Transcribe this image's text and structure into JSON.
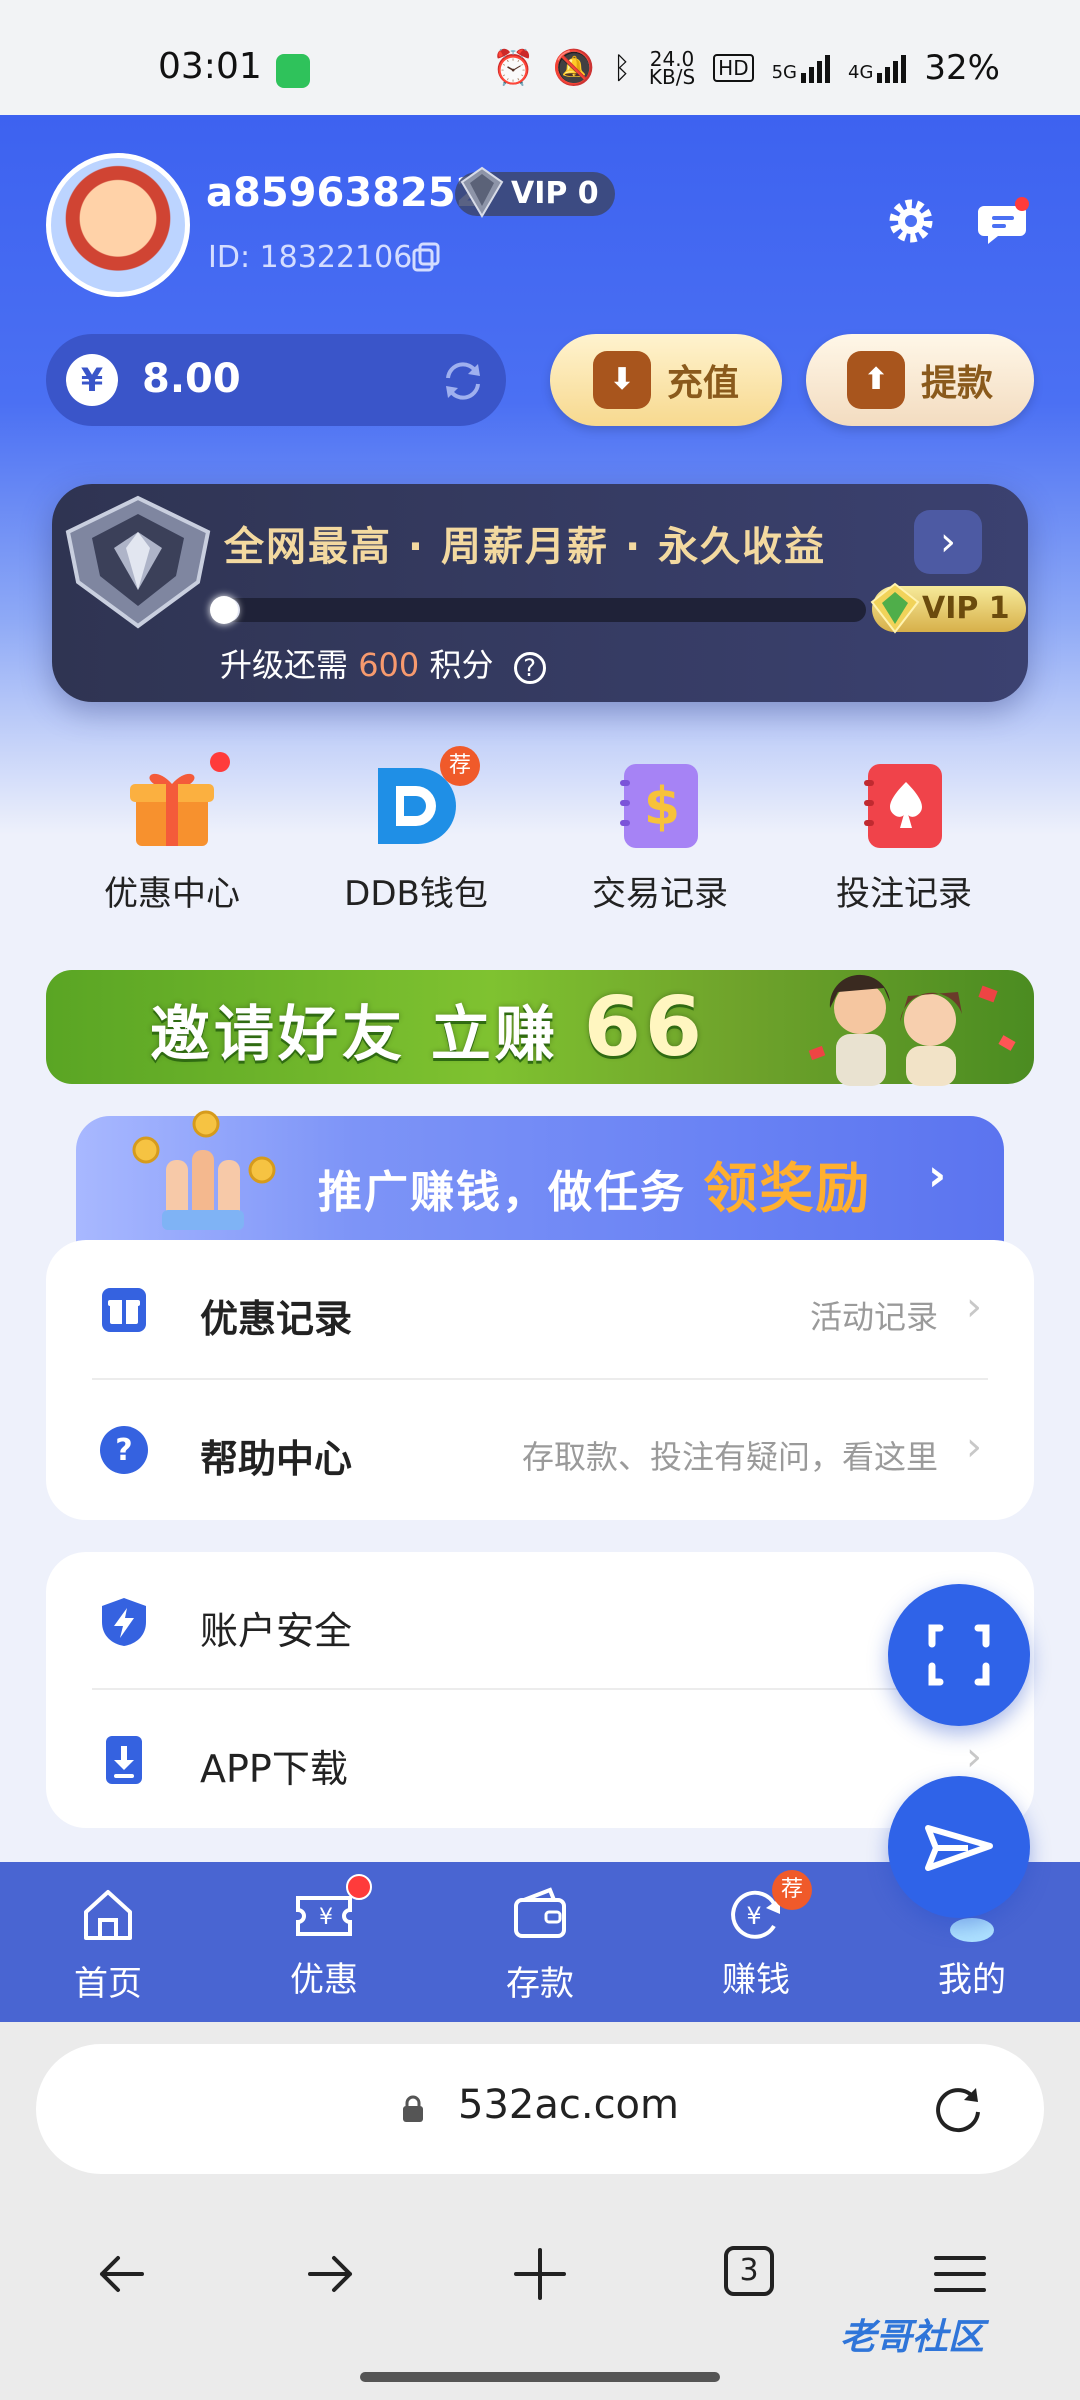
{
  "status_bar": {
    "time": "03:01",
    "net_speed": "24.0",
    "net_unit": "KB/S",
    "hd": "HD",
    "signal1": "5G",
    "signal2": "4G",
    "battery": "32%"
  },
  "profile": {
    "username": "a859638252",
    "vip_level": "VIP 0",
    "user_id": "ID: 18322106"
  },
  "wallet": {
    "currency_symbol": "¥",
    "balance": "8.00",
    "recharge_label": "充值",
    "withdraw_label": "提款"
  },
  "vip_card": {
    "title": "全网最高 · 周薪月薪 · 永久收益",
    "next_level": "VIP 1",
    "progress_prefix": "升级还需",
    "points_needed": "600",
    "progress_suffix": "积分",
    "progress_fraction": 0.02
  },
  "quick_actions": [
    {
      "label": "优惠中心",
      "icon": "gift-icon",
      "color": "#f7912e"
    },
    {
      "label": "DDB钱包",
      "icon": "ddb-wallet-icon",
      "badge": "荐",
      "color": "#1f8fe6"
    },
    {
      "label": "交易记录",
      "icon": "transaction-icon",
      "color": "#9b6cf2"
    },
    {
      "label": "投注记录",
      "icon": "betting-record-icon",
      "color": "#f0434a"
    }
  ],
  "invite_banner": {
    "text": "邀请好友 立赚",
    "amount": "66"
  },
  "promo_banner": {
    "text": "推广赚钱，做任务",
    "highlight": "领奖励"
  },
  "menu_card1": [
    {
      "label": "优惠记录",
      "desc": "活动记录",
      "icon": "gift-record-icon"
    },
    {
      "label": "帮助中心",
      "desc": "存取款、投注有疑问，看这里",
      "icon": "help-icon"
    }
  ],
  "menu_card2": [
    {
      "label": "账户安全",
      "icon": "shield-icon"
    },
    {
      "label": "APP下载",
      "icon": "download-icon"
    }
  ],
  "tabs": [
    {
      "label": "首页",
      "icon": "home-icon"
    },
    {
      "label": "优惠",
      "icon": "coupon-icon"
    },
    {
      "label": "存款",
      "icon": "wallet-icon"
    },
    {
      "label": "赚钱",
      "icon": "earn-icon",
      "badge": "荐"
    },
    {
      "label": "我的",
      "icon": "profile-icon"
    }
  ],
  "browser": {
    "url": "532ac.com",
    "tab_count": "3"
  },
  "watermark": "老哥社区",
  "colors": {
    "primary_blue": "#3d62f0",
    "tab_bar": "#4965d2",
    "accent_orange": "#f05a2a"
  }
}
